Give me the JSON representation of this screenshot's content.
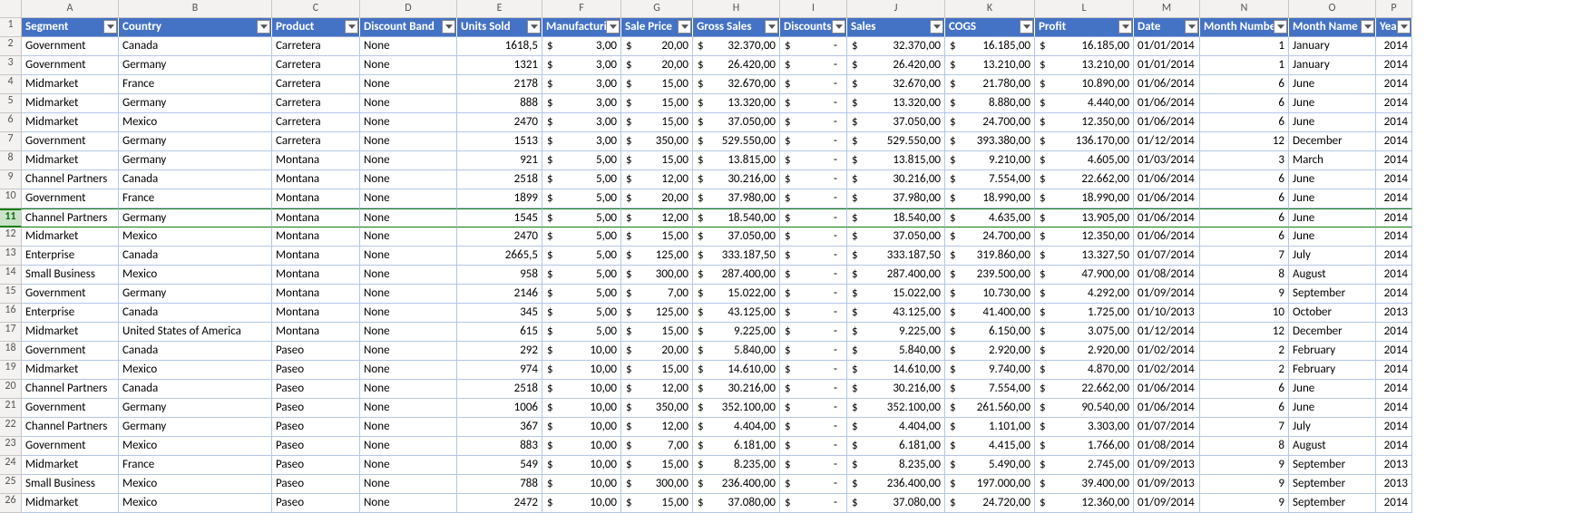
{
  "columns_letters": [
    "A",
    "B",
    "C",
    "D",
    "E",
    "F",
    "G",
    "H",
    "I",
    "J",
    "K",
    "L",
    "M",
    "N",
    "O",
    "P"
  ],
  "headers": [
    "Segment",
    "Country",
    "Product",
    "Discount Band",
    "Units Sold",
    "Manufacturin",
    "Sale Price",
    "Gross Sales",
    "Discounts",
    "Sales",
    "COGS",
    "Profit",
    "Date",
    "Month Number",
    "Month Name",
    "Year"
  ],
  "selected_row": 11,
  "chart_data": {
    "type": "table",
    "columns": [
      "Segment",
      "Country",
      "Product",
      "Discount Band",
      "Units Sold",
      "Manufacturing Price",
      "Sale Price",
      "Gross Sales",
      "Discounts",
      "Sales",
      "COGS",
      "Profit",
      "Date",
      "Month Number",
      "Month Name",
      "Year"
    ]
  },
  "rows": [
    {
      "n": 2,
      "segment": "Government",
      "country": "Canada",
      "product": "Carretera",
      "discount": "None",
      "units": "1618,5",
      "mfg": "3,00",
      "sale": "20,00",
      "gross": "32.370,00",
      "disc": "-",
      "sales": "32.370,00",
      "cogs": "16.185,00",
      "profit": "16.185,00",
      "date": "01/01/2014",
      "mnum": "1",
      "mname": "January",
      "year": "2014"
    },
    {
      "n": 3,
      "segment": "Government",
      "country": "Germany",
      "product": "Carretera",
      "discount": "None",
      "units": "1321",
      "mfg": "3,00",
      "sale": "20,00",
      "gross": "26.420,00",
      "disc": "-",
      "sales": "26.420,00",
      "cogs": "13.210,00",
      "profit": "13.210,00",
      "date": "01/01/2014",
      "mnum": "1",
      "mname": "January",
      "year": "2014"
    },
    {
      "n": 4,
      "segment": "Midmarket",
      "country": "France",
      "product": "Carretera",
      "discount": "None",
      "units": "2178",
      "mfg": "3,00",
      "sale": "15,00",
      "gross": "32.670,00",
      "disc": "-",
      "sales": "32.670,00",
      "cogs": "21.780,00",
      "profit": "10.890,00",
      "date": "01/06/2014",
      "mnum": "6",
      "mname": "June",
      "year": "2014"
    },
    {
      "n": 5,
      "segment": "Midmarket",
      "country": "Germany",
      "product": "Carretera",
      "discount": "None",
      "units": "888",
      "mfg": "3,00",
      "sale": "15,00",
      "gross": "13.320,00",
      "disc": "-",
      "sales": "13.320,00",
      "cogs": "8.880,00",
      "profit": "4.440,00",
      "date": "01/06/2014",
      "mnum": "6",
      "mname": "June",
      "year": "2014"
    },
    {
      "n": 6,
      "segment": "Midmarket",
      "country": "Mexico",
      "product": "Carretera",
      "discount": "None",
      "units": "2470",
      "mfg": "3,00",
      "sale": "15,00",
      "gross": "37.050,00",
      "disc": "-",
      "sales": "37.050,00",
      "cogs": "24.700,00",
      "profit": "12.350,00",
      "date": "01/06/2014",
      "mnum": "6",
      "mname": "June",
      "year": "2014"
    },
    {
      "n": 7,
      "segment": "Government",
      "country": "Germany",
      "product": "Carretera",
      "discount": "None",
      "units": "1513",
      "mfg": "3,00",
      "sale": "350,00",
      "gross": "529.550,00",
      "disc": "-",
      "sales": "529.550,00",
      "cogs": "393.380,00",
      "profit": "136.170,00",
      "date": "01/12/2014",
      "mnum": "12",
      "mname": "December",
      "year": "2014"
    },
    {
      "n": 8,
      "segment": "Midmarket",
      "country": "Germany",
      "product": "Montana",
      "discount": "None",
      "units": "921",
      "mfg": "5,00",
      "sale": "15,00",
      "gross": "13.815,00",
      "disc": "-",
      "sales": "13.815,00",
      "cogs": "9.210,00",
      "profit": "4.605,00",
      "date": "01/03/2014",
      "mnum": "3",
      "mname": "March",
      "year": "2014"
    },
    {
      "n": 9,
      "segment": "Channel Partners",
      "country": "Canada",
      "product": "Montana",
      "discount": "None",
      "units": "2518",
      "mfg": "5,00",
      "sale": "12,00",
      "gross": "30.216,00",
      "disc": "-",
      "sales": "30.216,00",
      "cogs": "7.554,00",
      "profit": "22.662,00",
      "date": "01/06/2014",
      "mnum": "6",
      "mname": "June",
      "year": "2014"
    },
    {
      "n": 10,
      "segment": "Government",
      "country": "France",
      "product": "Montana",
      "discount": "None",
      "units": "1899",
      "mfg": "5,00",
      "sale": "20,00",
      "gross": "37.980,00",
      "disc": "-",
      "sales": "37.980,00",
      "cogs": "18.990,00",
      "profit": "18.990,00",
      "date": "01/06/2014",
      "mnum": "6",
      "mname": "June",
      "year": "2014"
    },
    {
      "n": 11,
      "segment": "Channel Partners",
      "country": "Germany",
      "product": "Montana",
      "discount": "None",
      "units": "1545",
      "mfg": "5,00",
      "sale": "12,00",
      "gross": "18.540,00",
      "disc": "-",
      "sales": "18.540,00",
      "cogs": "4.635,00",
      "profit": "13.905,00",
      "date": "01/06/2014",
      "mnum": "6",
      "mname": "June",
      "year": "2014"
    },
    {
      "n": 12,
      "segment": "Midmarket",
      "country": "Mexico",
      "product": "Montana",
      "discount": "None",
      "units": "2470",
      "mfg": "5,00",
      "sale": "15,00",
      "gross": "37.050,00",
      "disc": "-",
      "sales": "37.050,00",
      "cogs": "24.700,00",
      "profit": "12.350,00",
      "date": "01/06/2014",
      "mnum": "6",
      "mname": "June",
      "year": "2014"
    },
    {
      "n": 13,
      "segment": "Enterprise",
      "country": "Canada",
      "product": "Montana",
      "discount": "None",
      "units": "2665,5",
      "mfg": "5,00",
      "sale": "125,00",
      "gross": "333.187,50",
      "disc": "-",
      "sales": "333.187,50",
      "cogs": "319.860,00",
      "profit": "13.327,50",
      "date": "01/07/2014",
      "mnum": "7",
      "mname": "July",
      "year": "2014"
    },
    {
      "n": 14,
      "segment": "Small Business",
      "country": "Mexico",
      "product": "Montana",
      "discount": "None",
      "units": "958",
      "mfg": "5,00",
      "sale": "300,00",
      "gross": "287.400,00",
      "disc": "-",
      "sales": "287.400,00",
      "cogs": "239.500,00",
      "profit": "47.900,00",
      "date": "01/08/2014",
      "mnum": "8",
      "mname": "August",
      "year": "2014"
    },
    {
      "n": 15,
      "segment": "Government",
      "country": "Germany",
      "product": "Montana",
      "discount": "None",
      "units": "2146",
      "mfg": "5,00",
      "sale": "7,00",
      "gross": "15.022,00",
      "disc": "-",
      "sales": "15.022,00",
      "cogs": "10.730,00",
      "profit": "4.292,00",
      "date": "01/09/2014",
      "mnum": "9",
      "mname": "September",
      "year": "2014"
    },
    {
      "n": 16,
      "segment": "Enterprise",
      "country": "Canada",
      "product": "Montana",
      "discount": "None",
      "units": "345",
      "mfg": "5,00",
      "sale": "125,00",
      "gross": "43.125,00",
      "disc": "-",
      "sales": "43.125,00",
      "cogs": "41.400,00",
      "profit": "1.725,00",
      "date": "01/10/2013",
      "mnum": "10",
      "mname": "October",
      "year": "2013"
    },
    {
      "n": 17,
      "segment": "Midmarket",
      "country": "United States of America",
      "product": "Montana",
      "discount": "None",
      "units": "615",
      "mfg": "5,00",
      "sale": "15,00",
      "gross": "9.225,00",
      "disc": "-",
      "sales": "9.225,00",
      "cogs": "6.150,00",
      "profit": "3.075,00",
      "date": "01/12/2014",
      "mnum": "12",
      "mname": "December",
      "year": "2014"
    },
    {
      "n": 18,
      "segment": "Government",
      "country": "Canada",
      "product": "Paseo",
      "discount": "None",
      "units": "292",
      "mfg": "10,00",
      "sale": "20,00",
      "gross": "5.840,00",
      "disc": "-",
      "sales": "5.840,00",
      "cogs": "2.920,00",
      "profit": "2.920,00",
      "date": "01/02/2014",
      "mnum": "2",
      "mname": "February",
      "year": "2014"
    },
    {
      "n": 19,
      "segment": "Midmarket",
      "country": "Mexico",
      "product": "Paseo",
      "discount": "None",
      "units": "974",
      "mfg": "10,00",
      "sale": "15,00",
      "gross": "14.610,00",
      "disc": "-",
      "sales": "14.610,00",
      "cogs": "9.740,00",
      "profit": "4.870,00",
      "date": "01/02/2014",
      "mnum": "2",
      "mname": "February",
      "year": "2014"
    },
    {
      "n": 20,
      "segment": "Channel Partners",
      "country": "Canada",
      "product": "Paseo",
      "discount": "None",
      "units": "2518",
      "mfg": "10,00",
      "sale": "12,00",
      "gross": "30.216,00",
      "disc": "-",
      "sales": "30.216,00",
      "cogs": "7.554,00",
      "profit": "22.662,00",
      "date": "01/06/2014",
      "mnum": "6",
      "mname": "June",
      "year": "2014"
    },
    {
      "n": 21,
      "segment": "Government",
      "country": "Germany",
      "product": "Paseo",
      "discount": "None",
      "units": "1006",
      "mfg": "10,00",
      "sale": "350,00",
      "gross": "352.100,00",
      "disc": "-",
      "sales": "352.100,00",
      "cogs": "261.560,00",
      "profit": "90.540,00",
      "date": "01/06/2014",
      "mnum": "6",
      "mname": "June",
      "year": "2014"
    },
    {
      "n": 22,
      "segment": "Channel Partners",
      "country": "Germany",
      "product": "Paseo",
      "discount": "None",
      "units": "367",
      "mfg": "10,00",
      "sale": "12,00",
      "gross": "4.404,00",
      "disc": "-",
      "sales": "4.404,00",
      "cogs": "1.101,00",
      "profit": "3.303,00",
      "date": "01/07/2014",
      "mnum": "7",
      "mname": "July",
      "year": "2014"
    },
    {
      "n": 23,
      "segment": "Government",
      "country": "Mexico",
      "product": "Paseo",
      "discount": "None",
      "units": "883",
      "mfg": "10,00",
      "sale": "7,00",
      "gross": "6.181,00",
      "disc": "-",
      "sales": "6.181,00",
      "cogs": "4.415,00",
      "profit": "1.766,00",
      "date": "01/08/2014",
      "mnum": "8",
      "mname": "August",
      "year": "2014"
    },
    {
      "n": 24,
      "segment": "Midmarket",
      "country": "France",
      "product": "Paseo",
      "discount": "None",
      "units": "549",
      "mfg": "10,00",
      "sale": "15,00",
      "gross": "8.235,00",
      "disc": "-",
      "sales": "8.235,00",
      "cogs": "5.490,00",
      "profit": "2.745,00",
      "date": "01/09/2013",
      "mnum": "9",
      "mname": "September",
      "year": "2013"
    },
    {
      "n": 25,
      "segment": "Small Business",
      "country": "Mexico",
      "product": "Paseo",
      "discount": "None",
      "units": "788",
      "mfg": "10,00",
      "sale": "300,00",
      "gross": "236.400,00",
      "disc": "-",
      "sales": "236.400,00",
      "cogs": "197.000,00",
      "profit": "39.400,00",
      "date": "01/09/2013",
      "mnum": "9",
      "mname": "September",
      "year": "2013"
    },
    {
      "n": 26,
      "segment": "Midmarket",
      "country": "Mexico",
      "product": "Paseo",
      "discount": "None",
      "units": "2472",
      "mfg": "10,00",
      "sale": "15,00",
      "gross": "37.080,00",
      "disc": "-",
      "sales": "37.080,00",
      "cogs": "24.720,00",
      "profit": "12.360,00",
      "date": "01/09/2014",
      "mnum": "9",
      "mname": "September",
      "year": "2014"
    }
  ]
}
